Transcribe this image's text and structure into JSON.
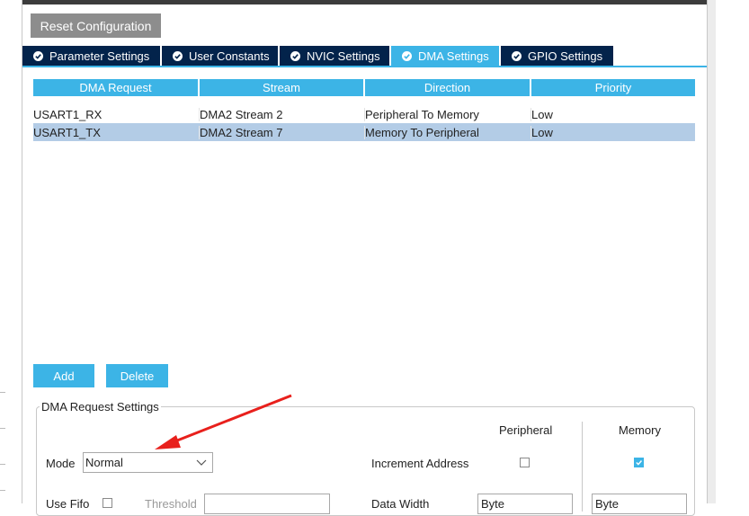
{
  "toolbar": {
    "reset_label": "Reset Configuration"
  },
  "tabs": [
    {
      "label": "Parameter Settings",
      "active": false
    },
    {
      "label": "User Constants",
      "active": false
    },
    {
      "label": "NVIC Settings",
      "active": false
    },
    {
      "label": "DMA Settings",
      "active": true
    },
    {
      "label": "GPIO Settings",
      "active": false
    }
  ],
  "grid": {
    "columns": [
      "DMA Request",
      "Stream",
      "Direction",
      "Priority"
    ],
    "rows": [
      [
        "USART1_RX",
        "DMA2 Stream 2",
        "Peripheral To Memory",
        "Low"
      ],
      [
        "USART1_TX",
        "DMA2 Stream 7",
        "Memory To Peripheral",
        "Low"
      ]
    ],
    "selected_row": 1
  },
  "buttons": {
    "add_label": "Add",
    "delete_label": "Delete"
  },
  "request_settings": {
    "legend": "DMA Request Settings",
    "col_peripheral": "Peripheral",
    "col_memory": "Memory",
    "mode_label": "Mode",
    "mode_value": "Normal",
    "increment_label": "Increment Address",
    "peripheral_increment": false,
    "memory_increment": true,
    "use_fifo_partial": "Use Fifo",
    "threshold_partial": "Threshold",
    "data_width_partial": "Data Width",
    "peripheral_width_partial": "Byte",
    "memory_width_partial": "Byte"
  },
  "colors": {
    "accent": "#3cb4e6",
    "tab_dark": "#03234b",
    "selection": "#b3cce6",
    "annotation_arrow": "#e8201c"
  }
}
